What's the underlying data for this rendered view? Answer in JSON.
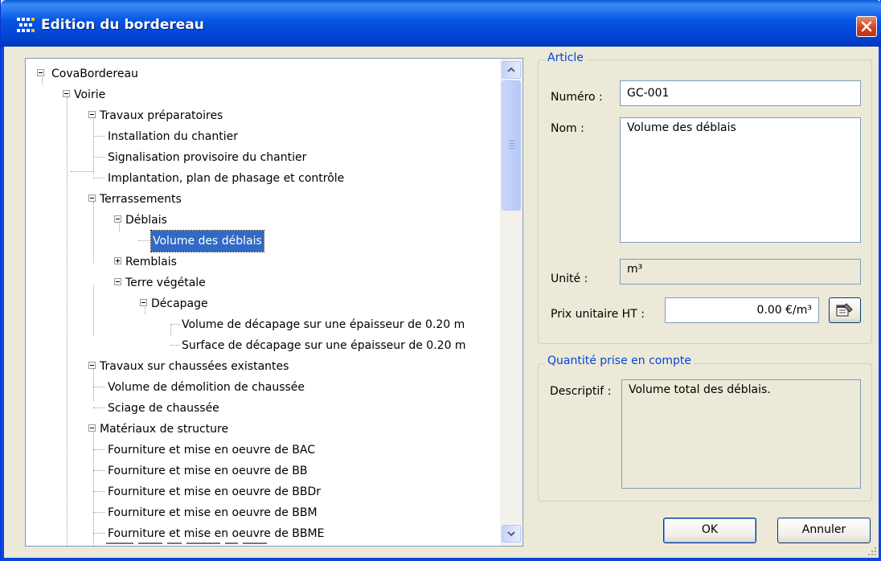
{
  "window": {
    "title": "Edition du bordereau"
  },
  "tree": {
    "items": [
      {
        "label": "CovaBordereau",
        "expander": "minus"
      },
      {
        "label": "Voirie",
        "expander": "minus"
      },
      {
        "label": "Travaux préparatoires",
        "expander": "minus"
      },
      {
        "label": "Installation du chantier"
      },
      {
        "label": "Signalisation provisoire du chantier"
      },
      {
        "label": "Implantation, plan de phasage et contrôle"
      },
      {
        "label": "Terrassements",
        "expander": "minus"
      },
      {
        "label": "Déblais",
        "expander": "minus"
      },
      {
        "label": "Volume des déblais",
        "selected": true
      },
      {
        "label": "Remblais",
        "expander": "plus"
      },
      {
        "label": "Terre végétale",
        "expander": "minus"
      },
      {
        "label": "Décapage",
        "expander": "minus"
      },
      {
        "label": "Volume de décapage sur une épaisseur de 0.20 m"
      },
      {
        "label": "Surface de décapage sur une épaisseur de 0.20 m"
      },
      {
        "label": "Travaux sur chaussées existantes",
        "expander": "minus"
      },
      {
        "label": "Volume de démolition de chaussée"
      },
      {
        "label": "Sciage de chaussée"
      },
      {
        "label": "Matériaux de structure",
        "expander": "minus"
      },
      {
        "label": "Fourniture et mise en oeuvre de BAC"
      },
      {
        "label": "Fourniture et mise en oeuvre de BB"
      },
      {
        "label": "Fourniture et mise en oeuvre de BBDr"
      },
      {
        "label": "Fourniture et mise en oeuvre de BBM"
      },
      {
        "label": "Fourniture et mise en oeuvre de BBME"
      }
    ]
  },
  "article": {
    "legend": "Article",
    "numero_label": "Numéro :",
    "numero_value": "GC-001",
    "nom_label": "Nom :",
    "nom_value": "Volume des déblais",
    "unite_label": "Unité :",
    "unite_value": "m³",
    "prix_label": "Prix unitaire HT :",
    "prix_value": "0.00 €/m³"
  },
  "quantite": {
    "legend": "Quantité prise en compte",
    "descriptif_label": "Descriptif :",
    "descriptif_value": "Volume total des déblais."
  },
  "buttons": {
    "ok": "OK",
    "annuler": "Annuler"
  },
  "colors": {
    "titlebar": "#0454e3",
    "selection": "#316ac5",
    "legend_text": "#0046d5",
    "dialog_face": "#ece9d8"
  },
  "icons": {
    "app": "grid-app-icon",
    "close": "close-icon",
    "scroll_up": "chevron-up-icon",
    "scroll_down": "chevron-down-icon",
    "properties": "properties-icon"
  }
}
